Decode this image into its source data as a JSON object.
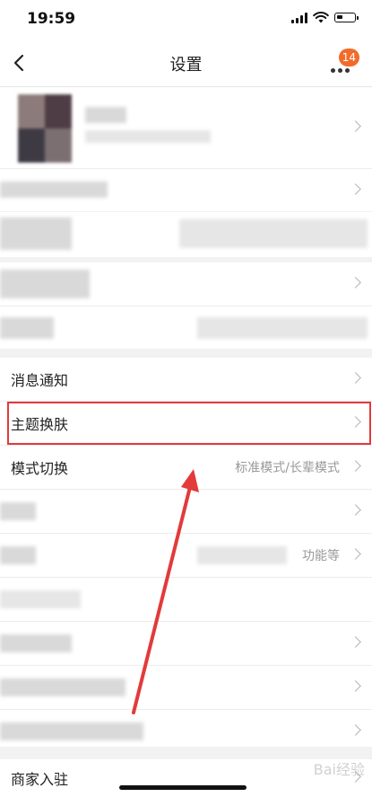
{
  "status_bar": {
    "time": "19:59"
  },
  "nav": {
    "title": "设置",
    "badge_count": "14"
  },
  "rows": {
    "notifications": "消息通知",
    "theme": "主题换肤",
    "mode_switch": "模式切换",
    "mode_value": "标准模式/长辈模式",
    "partial_value": "功能等",
    "merchant": "商家入驻"
  },
  "watermark": "Bai经验",
  "colors": {
    "highlight": "#e33a3a",
    "badge": "#f26b2c",
    "arrow": "#e33a3a"
  }
}
